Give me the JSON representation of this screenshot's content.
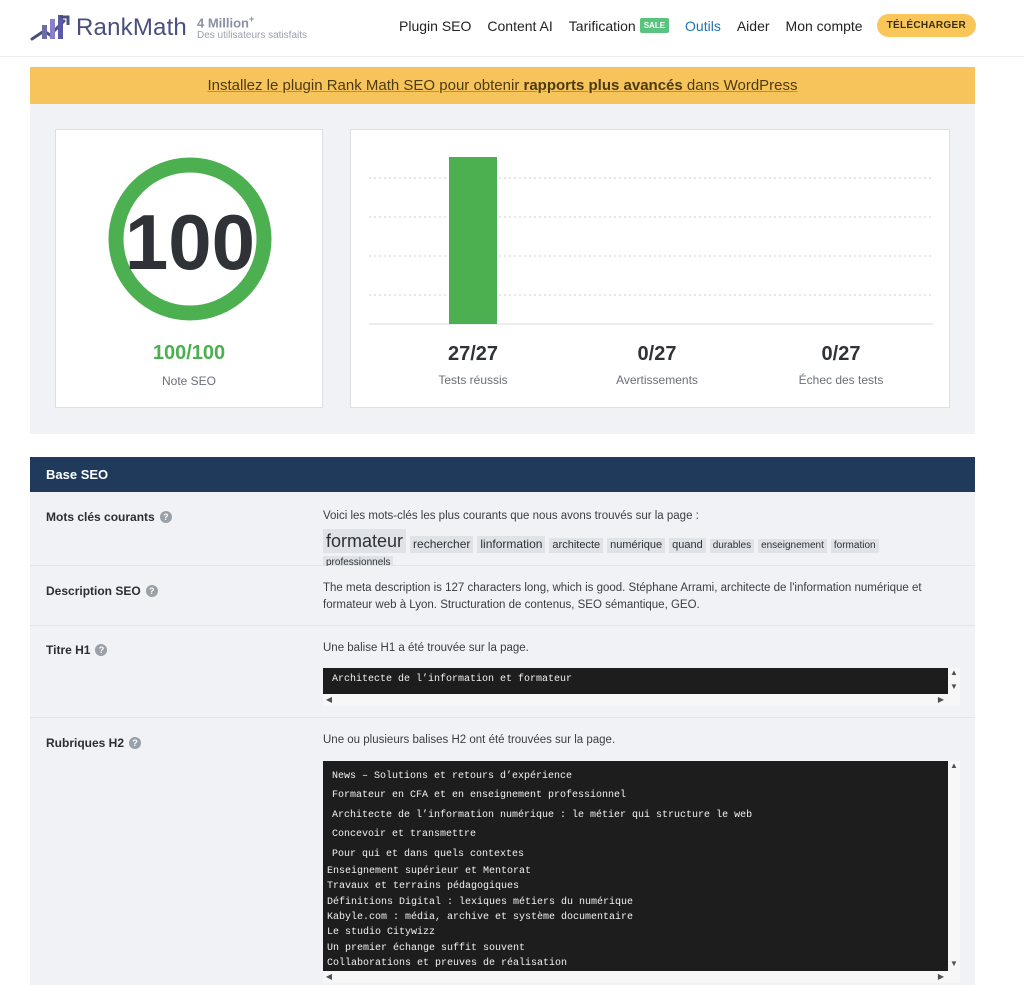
{
  "header": {
    "brand": "RankMath",
    "users_count": "4 Million",
    "users_plus": "+",
    "users_caption": "Des utilisateurs satisfaits",
    "nav": [
      {
        "label": "Plugin SEO"
      },
      {
        "label": "Content AI"
      },
      {
        "label": "Tarification",
        "badge": "SALE"
      },
      {
        "label": "Outils",
        "active": true
      },
      {
        "label": "Aider"
      },
      {
        "label": "Mon compte"
      }
    ],
    "download_label": "TÉLÉCHARGER",
    "colors": {
      "brand": "#4a4f7c",
      "accent": "#f9c65a",
      "sale": "#58c47d",
      "active": "#1f73b7"
    }
  },
  "banner": {
    "text_before": "Installez le plugin Rank Math SEO pour obtenir ",
    "text_bold": "rapports plus avancés",
    "text_after": " dans WordPress"
  },
  "score": {
    "value": "100",
    "fraction": "100/100",
    "label": "Note SEO",
    "color": "#4caf50"
  },
  "stats": [
    {
      "value": "27/27",
      "label": "Tests réussis"
    },
    {
      "value": "0/27",
      "label": "Avertissements"
    },
    {
      "value": "0/27",
      "label": "Échec des tests"
    }
  ],
  "chart_data": {
    "type": "bar",
    "categories": [
      "Tests réussis",
      "Avertissements",
      "Échec des tests"
    ],
    "values": [
      27,
      0,
      0
    ],
    "ylim": [
      0,
      30
    ],
    "grid": true,
    "bar_color": "#4caf50"
  },
  "base_seo": {
    "title": "Base SEO",
    "keywords": {
      "label": "Mots clés courants",
      "intro": "Voici les mots-clés les plus courants que nous avons trouvés sur la page :",
      "items": [
        "formateur",
        "rechercher",
        "linformation",
        "architecte",
        "numérique",
        "quand",
        "durables",
        "enseignement",
        "formation",
        "professionnels"
      ]
    },
    "description": {
      "label": "Description SEO",
      "text": "The meta description is 127 characters long, which is good. Stéphane Arrami, architecte de l'information numérique et formateur web à Lyon. Structuration de contenus, SEO sémantique, GEO."
    },
    "h1": {
      "label": "Titre H1",
      "intro": "Une balise H1 a été trouvée sur la page.",
      "items": [
        "Architecte de l’information et formateur"
      ]
    },
    "h2": {
      "label": "Rubriques H2",
      "intro": "Une ou plusieurs balises H2 ont été trouvées sur la page.",
      "items": [
        "News – Solutions et retours d’expérience",
        "Formateur en CFA et en enseignement professionnel",
        "Architecte de l’information numérique : le métier qui structure le web",
        "Concevoir et transmettre",
        "Pour qui et dans quels contextes",
        "Enseignement supérieur et Mentorat",
        "Travaux et terrains pédagogiques",
        "Définitions Digital : lexiques métiers du numérique",
        "Kabyle.com : média, archive et système documentaire",
        "Le studio Citywizz",
        "Un premier échange suffit souvent",
        "Collaborations et preuves de réalisation"
      ]
    }
  }
}
